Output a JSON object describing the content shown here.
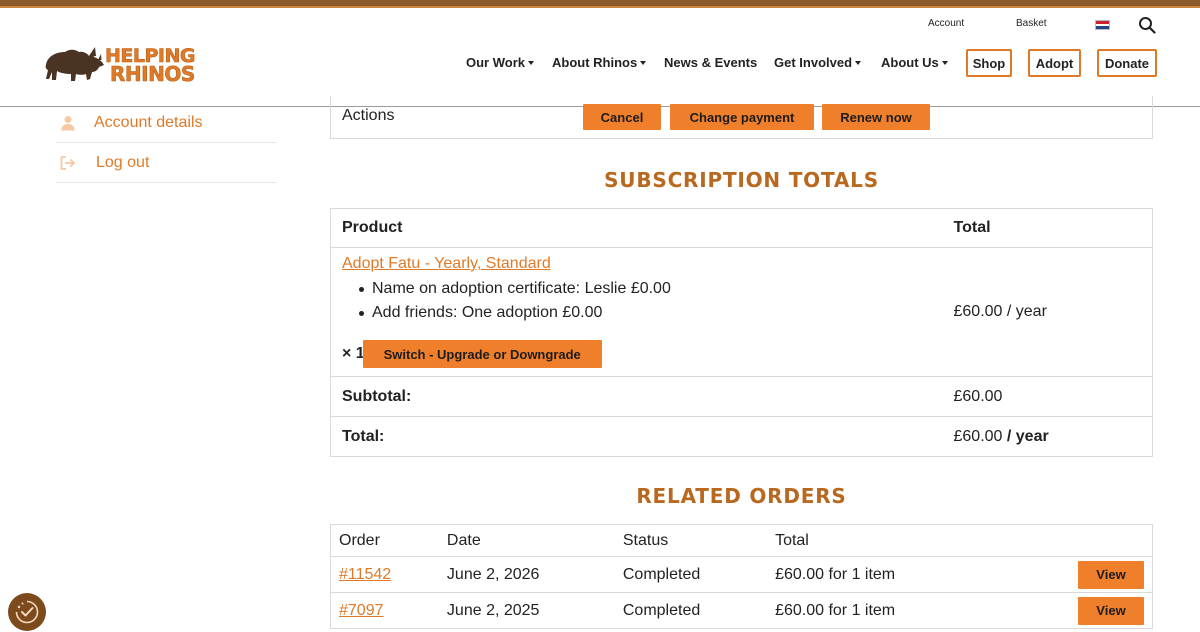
{
  "header": {
    "utility": {
      "account": "Account",
      "basket": "Basket"
    },
    "logo": {
      "line1": "HELPING",
      "line2": "RHINOS"
    },
    "nav": [
      {
        "label": "Our Work",
        "dropdown": true
      },
      {
        "label": "About Rhinos",
        "dropdown": true
      },
      {
        "label": "News & Events",
        "dropdown": false
      },
      {
        "label": "Get Involved",
        "dropdown": true
      },
      {
        "label": "About Us",
        "dropdown": true
      }
    ],
    "buttons": {
      "shop": "Shop",
      "adopt": "Adopt",
      "donate": "Donate"
    },
    "icons": {
      "search": "search-icon",
      "language": "dutch-flag-icon"
    }
  },
  "sidebar": {
    "items": [
      {
        "label": "Account details",
        "icon": "user-icon"
      },
      {
        "label": "Log out",
        "icon": "logout-icon"
      }
    ]
  },
  "actions": {
    "label": "Actions",
    "cancel": "Cancel",
    "change_payment": "Change payment",
    "renew_now": "Renew now"
  },
  "subscription_totals": {
    "title": "SUBSCRIPTION TOTALS",
    "headers": {
      "product": "Product",
      "total": "Total"
    },
    "product": {
      "name": "Adopt Fatu - Yearly, Standard",
      "meta": [
        "Name on adoption certificate: Leslie £0.00",
        "Add friends: One adoption £0.00"
      ],
      "quantity": "× 1",
      "switch_button": "Switch - Upgrade or Downgrade",
      "price": "£60.00",
      "period": " / year"
    },
    "subtotal": {
      "label": "Subtotal:",
      "value": "£60.00"
    },
    "total": {
      "label": "Total:",
      "value": "£60.00",
      "period": " / year"
    }
  },
  "related_orders": {
    "title": "RELATED ORDERS",
    "headers": {
      "order": "Order",
      "date": "Date",
      "status": "Status",
      "total": "Total"
    },
    "rows": [
      {
        "order": "#11542",
        "date": "June 2, 2026",
        "status": "Completed",
        "total": "£60.00 for 1 item",
        "action": "View"
      },
      {
        "order": "#7097",
        "date": "June 2, 2025",
        "status": "Completed",
        "total": "£60.00 for 1 item",
        "action": "View"
      }
    ]
  },
  "colors": {
    "accent": "#ef7f2a",
    "heading": "#b8691f",
    "topbar": "#8a5a2b"
  },
  "cookie": {
    "icon": "cookie-settings-icon"
  }
}
